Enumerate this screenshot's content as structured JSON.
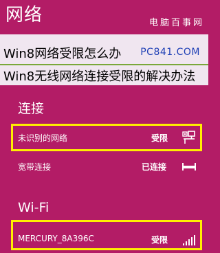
{
  "header": {
    "title": "网络",
    "watermark": "电脑百事网"
  },
  "banner": {
    "line1": "Win8网络受限怎么办",
    "site": "PC841.COM",
    "line2": "Win8无线网络连接受限的解决办法"
  },
  "sections": {
    "connections": {
      "heading": "连接",
      "items": [
        {
          "name": "未识别的网络",
          "status": "受限",
          "icon": "wired-network-icon"
        },
        {
          "name": "宽带连接",
          "status": "已连接",
          "icon": "broadband-icon"
        }
      ]
    },
    "wifi": {
      "heading": "Wi-Fi",
      "items": [
        {
          "name": "MERCURY_8A396C",
          "status": "受限",
          "icon": "wifi-signal-icon"
        }
      ]
    }
  },
  "colors": {
    "background": "#b31c66",
    "highlight": "#ffee00",
    "band": "#f0e6f0",
    "divider": "#7aa83a",
    "site_link": "#1e3fb5"
  }
}
